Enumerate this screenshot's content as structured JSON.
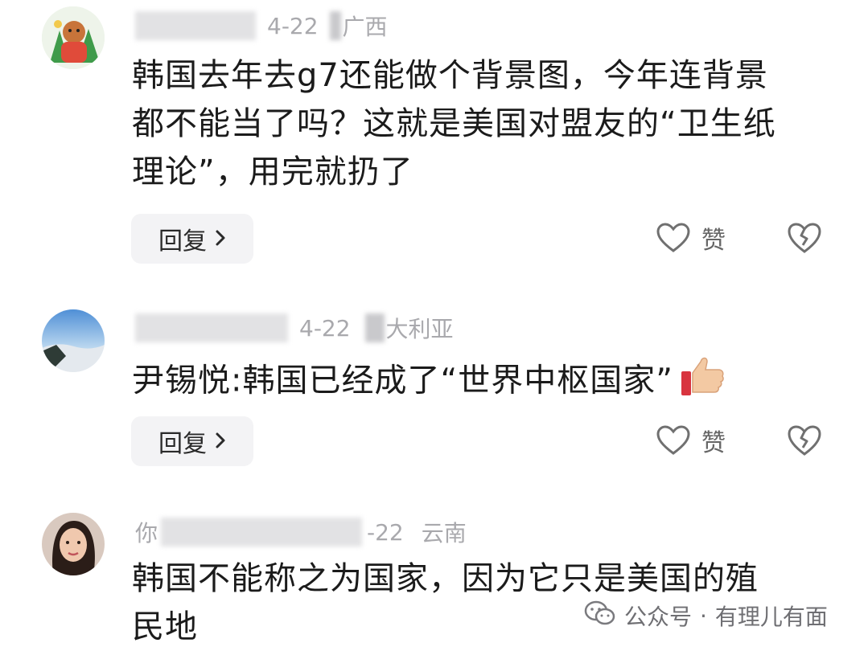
{
  "comments": [
    {
      "date": "4-22",
      "region": "广西",
      "text_lines": [
        "韩国去年去g7还能做个背景图，今年连背景",
        "都不能当了吗？这就是美国对盟友的“卫生纸",
        "理论”，用完就扔了"
      ],
      "reply_label": "回复",
      "like_label": "赞"
    },
    {
      "date": "4-22",
      "region": "大利亚",
      "text_lines": [
        "尹锡悦:韩国已经成了“世界中枢国家”"
      ],
      "reply_label": "回复",
      "like_label": "赞"
    },
    {
      "date": "-22",
      "region": "云南",
      "name_prefix": "你",
      "text_lines": [
        "韩国不能称之为国家，因为它只是美国的殖",
        "民地"
      ]
    }
  ],
  "watermark": {
    "icon": "wechat-icon",
    "platform": "公众号",
    "separator": "·",
    "account": "有理儿有面"
  },
  "icons": {
    "reply_chevron": "chevron-right-icon",
    "like": "heart-outline-icon",
    "dislike": "broken-heart-icon",
    "emoji": "thumbs-up-emoji"
  }
}
